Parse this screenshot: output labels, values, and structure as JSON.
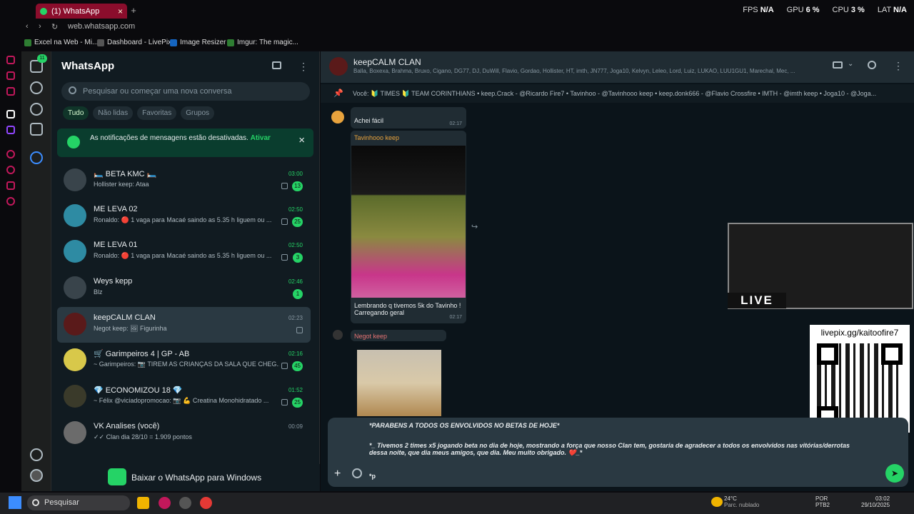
{
  "browser": {
    "tab_title": "(1) WhatsApp",
    "url": "web.whatsapp.com",
    "stats": {
      "fps_label": "FPS",
      "fps": "N/A",
      "gpu_label": "GPU",
      "gpu": "6 %",
      "cpu_label": "CPU",
      "cpu": "3 %",
      "lat_label": "LAT",
      "lat": "N/A"
    },
    "bookmarks": [
      "Excel na Web - Mi...",
      "Dashboard - LivePix",
      "Image Resizer",
      "Imgur: The magic..."
    ]
  },
  "sidebar": {
    "title": "WhatsApp",
    "unread_badge": "11",
    "search_placeholder": "Pesquisar ou começar uma nova conversa",
    "filters": [
      "Tudo",
      "Não lidas",
      "Favoritas",
      "Grupos"
    ],
    "notification": {
      "text": "As notificações de mensagens estão desativadas.",
      "action": "Ativar"
    },
    "chats": [
      {
        "name": "🛏️ BETA KMC 🛏️",
        "preview": "Hollister keep: Ataa",
        "time": "03:00",
        "badge": "13"
      },
      {
        "name": "ME LEVA 02",
        "preview": "Ronaldo: 🔴 1 vaga para Macaé saindo as 5.35 h liguem ou ...",
        "time": "02:50",
        "badge": "25"
      },
      {
        "name": "ME LEVA 01",
        "preview": "Ronaldo: 🔴 1 vaga para Macaé saindo as 5.35 h liguem ou ...",
        "time": "02:50",
        "badge": "3"
      },
      {
        "name": "Weys kepp",
        "preview": "Blz",
        "time": "02:46",
        "badge": "1"
      },
      {
        "name": "keepCALM CLAN",
        "preview": "Negot keep: 🖼 Figurinha",
        "time": "02:23",
        "badge": ""
      },
      {
        "name": "🛒 Garimpeiros 4 | GP - AB",
        "preview": "~ Garimpeiros: 📷 TIREM AS CRIANÇAS DA SALA QUE CHEG...",
        "time": "02:16",
        "badge": "45"
      },
      {
        "name": "💎 ECONOMIZOU 18 💎",
        "preview": "~ Félix @viciadopromocao: 📷 💪 Creatina Monohidratado ...",
        "time": "01:52",
        "badge": "25"
      },
      {
        "name": "VK Analises (você)",
        "preview": "✓✓ Clan dia 28/10 = 1.909 pontos",
        "time": "00:09",
        "badge": ""
      }
    ],
    "download_label": "Baixar o WhatsApp para Windows"
  },
  "conversation": {
    "group_name": "keepCALM CLAN",
    "members": "Balla, Boxexa, Brahma, Bruxo, Cigano, DG77, DJ, DuWill, Flavio, Gordao, Hollister, HT, imth, JN777, Joga10, Kelvyn, Leleo, Lord, Luiz, LUKAO, LUU1GU1, Marechal, Mec, ...",
    "pinned": "Você: 🔰 TIMES 🔰 TEAM CORINTHIANS • keep.Crack - @Ricardo Fire7 • Tavinhoo - @Tavinhooo keep • keep.donk666 - @Flavio Crossfire • IMTH - @imth keep • Joga10 - @Joga...",
    "messages": [
      {
        "text": "Achei fácil",
        "time": "02:17"
      },
      {
        "sender": "Tavinhooo keep",
        "text": "Lembrando q tivemos 5k do Tavinho ! Carregando geral",
        "time": "02:17"
      },
      {
        "sender": "Negot keep"
      }
    ],
    "compose": {
      "line1": "*PARABENS A TODOS OS ENVOLVIDOS NO BETAS DE HOJE*",
      "line2": "*_ Tivemos 2 times x5 jogando beta no dia de hoje, mostrando a força que nosso Clan tem, gostaria de agradecer a todos os envolvidos nas vitórias/derrotas dessa noite, que dia meus amigos, que dia. Meu muito obrigado. ❤️_*",
      "line3": "*p"
    }
  },
  "overlay": {
    "live": "LIVE",
    "qr_url": "livepix.gg/kaitoofire7"
  },
  "taskbar": {
    "search": "Pesquisar",
    "temp": "24°C",
    "weather": "Parc. nublado",
    "lang1": "POR",
    "lang2": "PTB2",
    "time": "03:02",
    "date": "29/10/2025"
  }
}
